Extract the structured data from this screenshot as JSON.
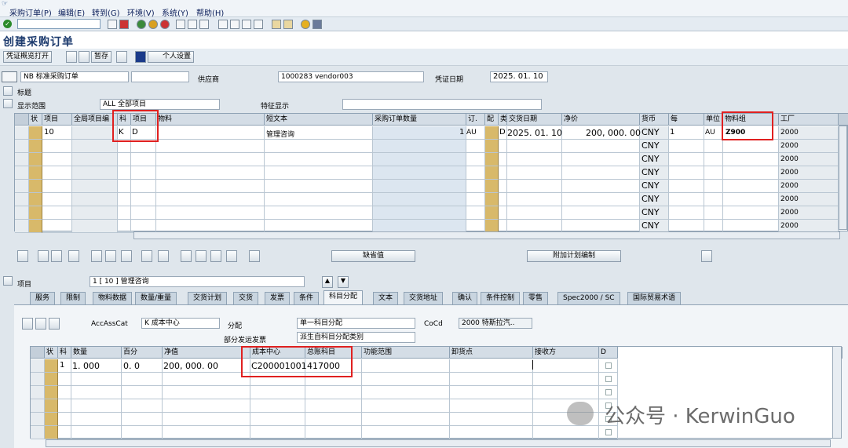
{
  "menu": [
    "采购订单(P)",
    "编辑(E)",
    "转到(G)",
    "环境(V)",
    "系统(Y)",
    "帮助(H)"
  ],
  "title": "创建采购订单",
  "toolbar": {
    "overview": "凭证概览打开",
    "hold": "暂存",
    "personal": "个人设置"
  },
  "header": {
    "doc_type": "NB 标准采购订单",
    "vendor_label": "供应商",
    "vendor": "1000283 vendor003",
    "docdate_label": "凭证日期",
    "docdate": "2025. 01. 10",
    "header_label": "标题",
    "scope_label": "显示范围",
    "scope": "ALL 全部项目",
    "feature_label": "特征显示"
  },
  "grid1": {
    "cols": [
      "状",
      "项目",
      "全局项目编",
      "科",
      "项目",
      "物料",
      "短文本",
      "采购订单数量",
      "订.",
      "配",
      "类",
      "交货日期",
      "净价",
      "货币",
      "每",
      "单位",
      "物料组",
      "工厂"
    ],
    "row1": {
      "item": "10",
      "acct": "K",
      "cat": "D",
      "text": "管理咨询",
      "qty": "1",
      "unit": "AU",
      "d": "D",
      "date": "2025. 01. 10",
      "price": "200, 000. 00",
      "cur": "CNY",
      "per": "1",
      "unit2": "AU",
      "matgrp": "Z900",
      "plant": "2000"
    },
    "cur": "CNY",
    "plant": "2000"
  },
  "mid": {
    "default_btn": "缺省值",
    "plan_btn": "附加计划编制"
  },
  "item_sel": {
    "label": "项目",
    "value": "1 [ 10 ] 管理咨询"
  },
  "tabs": [
    "服务",
    "限制",
    "物料数据",
    "数量/重量",
    "交货计划",
    "交货",
    "发票",
    "条件",
    "科目分配",
    "文本",
    "交货地址",
    "确认",
    "条件控制",
    "零售",
    "Spec2000 / SC",
    "国际贸易术语"
  ],
  "acct": {
    "cat_label": "AccAssCat",
    "cat": "K 成本中心",
    "dist_label": "分配",
    "dist": "单一科目分配",
    "partial_label": "部分发运发票",
    "partial": "派生自科目分配类别",
    "cocd_label": "CoCd",
    "cocd": "2000 特斯拉汽.."
  },
  "grid2": {
    "cols": [
      "状",
      "科",
      "数量",
      "百分",
      "净值",
      "成本中心",
      "总账科目",
      "功能范围",
      "卸货点",
      "接收方",
      "D"
    ],
    "row1": {
      "n": "1",
      "qty": "1. 000",
      "pct": "0. 0",
      "net": "200, 000. 00",
      "cc": "C200001001",
      "gl": "417000"
    }
  },
  "watermark": "公众号 · KerwinGuo"
}
